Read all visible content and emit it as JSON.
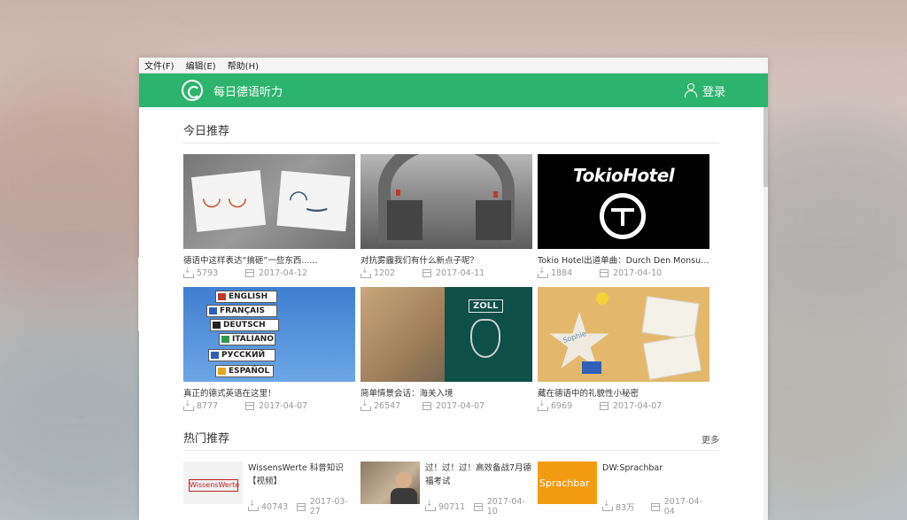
{
  "menubar": {
    "items": [
      "文件(F)",
      "编辑(E)",
      "帮助(H)"
    ]
  },
  "header": {
    "app_title": "每日德语听力",
    "login_label": "登录"
  },
  "today": {
    "title": "今日推荐",
    "cards": [
      {
        "title": "德语中这样表达“搞砸”一些东西......",
        "downloads": "5793",
        "date": "2017-04-12",
        "thumb": "emoji-signs-image"
      },
      {
        "title": "对抗雾霾我们有什么新点子呢？",
        "downloads": "1202",
        "date": "2017-04-11",
        "thumb": "smog-village-image"
      },
      {
        "title": "Tokio Hotel出道单曲：Durch Den Monsun ...",
        "downloads": "1884",
        "date": "2017-04-10",
        "thumb": "tokio-hotel-image",
        "thumb_text": "TokioHotel"
      },
      {
        "title": "真正的德式英语在这里！",
        "downloads": "8777",
        "date": "2017-04-07",
        "thumb": "language-signs-image",
        "signs": [
          "ENGLISH",
          "FRANÇAIS",
          "DEUTSCH",
          "ITALIANO",
          "РУССКИЙ",
          "ESPAÑOL"
        ]
      },
      {
        "title": "简单情景会话：海关入境",
        "downloads": "26547",
        "date": "2017-04-07",
        "thumb": "customs-image",
        "thumb_text": "ZOLL"
      },
      {
        "title": "藏在德语中的礼貌性小秘密",
        "downloads": "6969",
        "date": "2017-04-07",
        "thumb": "sophie-star-image",
        "thumb_text": "Sophie"
      }
    ]
  },
  "hot": {
    "title": "热门推荐",
    "more_label": "更多",
    "items": [
      {
        "title": "WissensWerte 科普知识【视频】",
        "downloads": "40743",
        "date": "2017-03-27",
        "thumb_text": "WissensWerte"
      },
      {
        "title": "过！过！过！高效备战7月德福考试",
        "downloads": "90711",
        "date": "2017-04-10"
      },
      {
        "title": "DW:Sprachbar",
        "downloads": "83万",
        "date": "2017-04-04",
        "thumb_text": "Sprachbar"
      }
    ]
  },
  "colors": {
    "header_green": "#2db46c",
    "text_dark": "#333333",
    "text_muted": "#999999"
  }
}
